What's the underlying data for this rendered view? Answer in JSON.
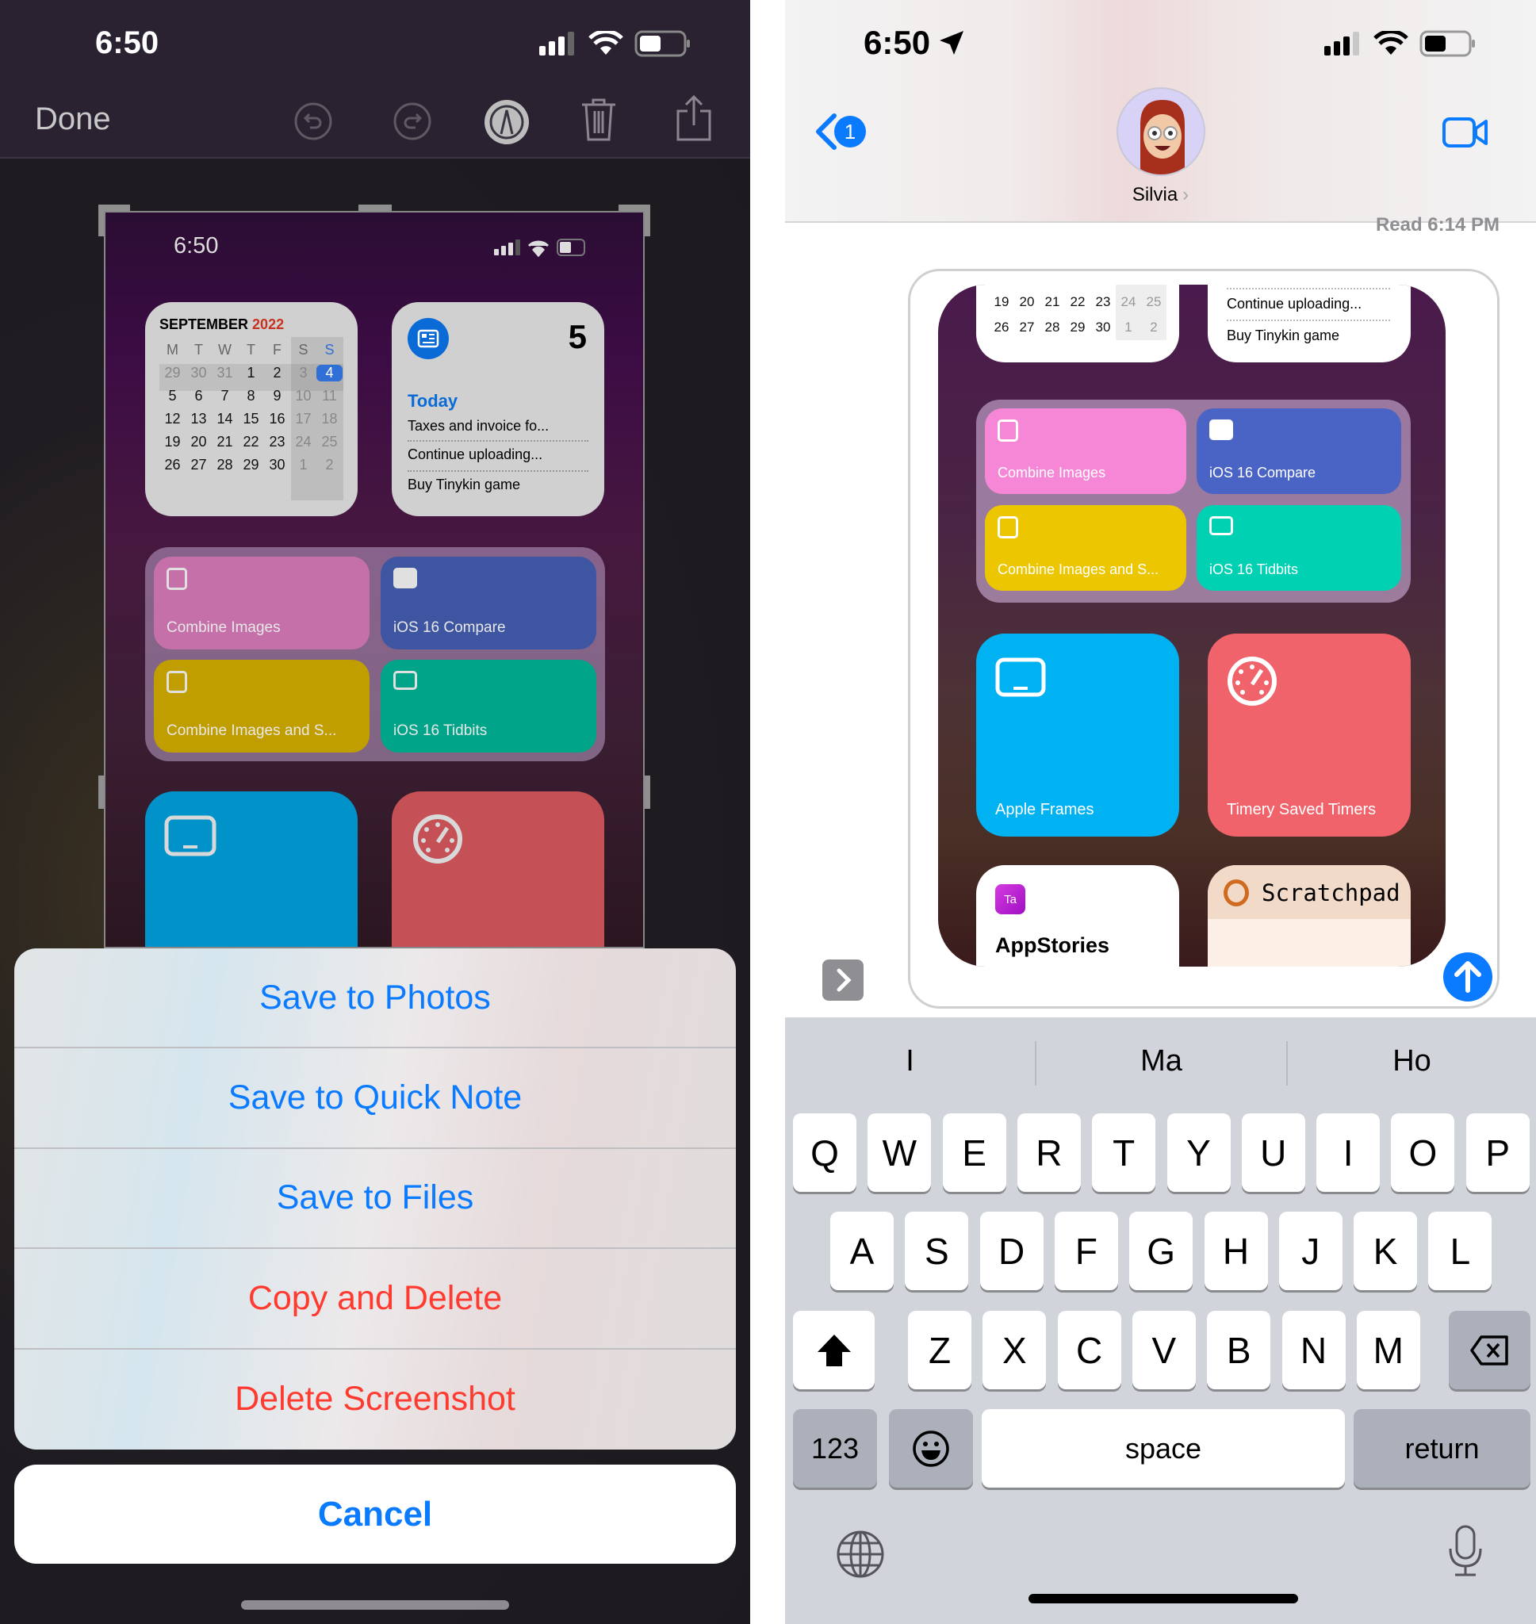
{
  "left": {
    "status": {
      "time": "6:50"
    },
    "toolbar": {
      "done": "Done",
      "icons": [
        "undo-icon",
        "redo-icon",
        "markup-pen-icon",
        "trash-icon",
        "share-icon"
      ]
    },
    "thumbnail": {
      "status_time": "6:50",
      "calendar": {
        "month": "SEPTEMBER",
        "year": "2022",
        "weekdays": [
          "M",
          "T",
          "W",
          "T",
          "F",
          "S",
          "S"
        ],
        "weeks": [
          [
            "29",
            "30",
            "31",
            "1",
            "2",
            "3",
            "4"
          ],
          [
            "5",
            "6",
            "7",
            "8",
            "9",
            "10",
            "11"
          ],
          [
            "12",
            "13",
            "14",
            "15",
            "16",
            "17",
            "18"
          ],
          [
            "19",
            "20",
            "21",
            "22",
            "23",
            "24",
            "25"
          ],
          [
            "26",
            "27",
            "28",
            "29",
            "30",
            "1",
            "2"
          ]
        ],
        "today": "4"
      },
      "reminders": {
        "count": "5",
        "title": "Today",
        "items": [
          "Taxes and invoice fo...",
          "Continue uploading...",
          "Buy Tinykin game"
        ]
      },
      "shortcuts": [
        {
          "label": "Combine Images",
          "color": "#c670aa"
        },
        {
          "label": "iOS 16 Compare",
          "color": "#3e56a2"
        },
        {
          "label": "Combine Images and S...",
          "color": "#c09e00"
        },
        {
          "label": "iOS 16 Tidbits",
          "color": "#00a589"
        }
      ],
      "large_tiles": [
        {
          "color": "#0092c8"
        },
        {
          "color": "#c55055"
        }
      ]
    },
    "sheet": {
      "actions": [
        {
          "label": "Save to Photos",
          "color": "#0a7aff"
        },
        {
          "label": "Save to Quick Note",
          "color": "#0a7aff"
        },
        {
          "label": "Save to Files",
          "color": "#0a7aff"
        },
        {
          "label": "Copy and Delete",
          "color": "#ff3b30"
        },
        {
          "label": "Delete Screenshot",
          "color": "#ff3b30"
        }
      ],
      "cancel": "Cancel"
    }
  },
  "right": {
    "status": {
      "time": "6:50"
    },
    "header": {
      "back_badge": "1",
      "contact": "Silvia",
      "read_receipt": "Read 6:14 PM"
    },
    "preview": {
      "cal_rows": [
        [
          "19",
          "20",
          "21",
          "22",
          "23",
          "24",
          "25"
        ],
        [
          "26",
          "27",
          "28",
          "29",
          "30",
          "1",
          "2"
        ]
      ],
      "reminder_items": [
        "Continue uploading...",
        "Buy Tinykin game"
      ],
      "shortcuts": [
        {
          "label": "Combine Images",
          "color": "#f587d6"
        },
        {
          "label": "iOS 16 Compare",
          "color": "#4a64c5"
        },
        {
          "label": "Combine Images and S...",
          "color": "#ecc600"
        },
        {
          "label": "iOS 16 Tidbits",
          "color": "#00d1b2"
        }
      ],
      "large": [
        {
          "label": "Apple Frames",
          "color": "#00b2f2"
        },
        {
          "label": "Timery Saved Timers",
          "color": "#f0636a"
        }
      ],
      "appstories": {
        "badge": "Ta",
        "title": "AppStories"
      },
      "scratchpad": {
        "title": "Scratchpad"
      }
    },
    "keyboard": {
      "suggestions": [
        "I",
        "Ma",
        "Ho"
      ],
      "row1": [
        "Q",
        "W",
        "E",
        "R",
        "T",
        "Y",
        "U",
        "I",
        "O",
        "P"
      ],
      "row2": [
        "A",
        "S",
        "D",
        "F",
        "G",
        "H",
        "J",
        "K",
        "L"
      ],
      "row3": [
        "Z",
        "X",
        "C",
        "V",
        "B",
        "N",
        "M"
      ],
      "numbers": "123",
      "space": "space",
      "return": "return"
    }
  }
}
